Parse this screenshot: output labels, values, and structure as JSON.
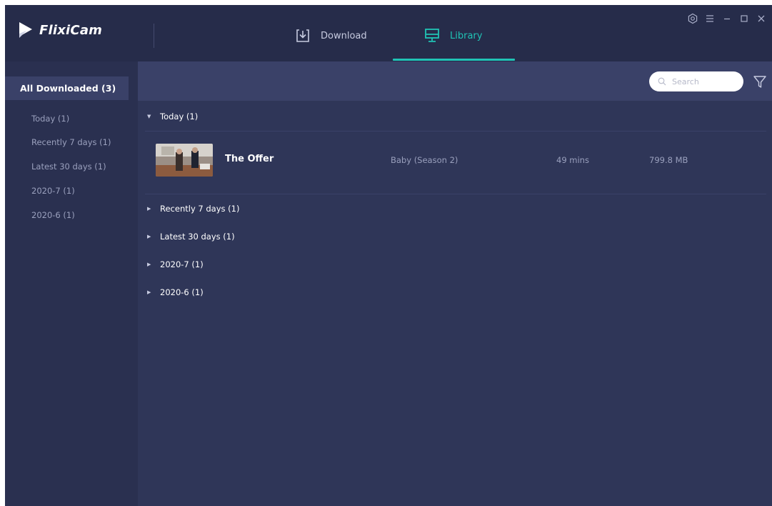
{
  "app": {
    "name": "FlixiCam",
    "accent": "#20c3b5"
  },
  "tabs": [
    {
      "label": "Download",
      "icon": "download-icon",
      "active": false
    },
    {
      "label": "Library",
      "icon": "monitor-icon",
      "active": true
    }
  ],
  "window_controls": [
    "settings-icon",
    "menu-icon",
    "minimize-icon",
    "maximize-icon",
    "close-icon"
  ],
  "sidebar": {
    "items": [
      {
        "label": "All Downloaded (3)",
        "active": true
      },
      {
        "label": "Today (1)"
      },
      {
        "label": "Recently 7 days (1)"
      },
      {
        "label": "Latest 30 days (1)"
      },
      {
        "label": "2020-7 (1)"
      },
      {
        "label": "2020-6 (1)"
      }
    ]
  },
  "toolbar": {
    "search_placeholder": "Search",
    "filter_icon": "filter-icon"
  },
  "groups": [
    {
      "label": "Today (1)",
      "expanded": true
    },
    {
      "label": "Recently 7 days (1)",
      "expanded": false
    },
    {
      "label": "Latest 30 days (1)",
      "expanded": false
    },
    {
      "label": "2020-7 (1)",
      "expanded": false
    },
    {
      "label": "2020-6 (1)",
      "expanded": false
    }
  ],
  "rows": [
    {
      "title": "The Offer",
      "series": "Baby (Season 2)",
      "duration": "49 mins",
      "size": "799.8 MB"
    }
  ]
}
